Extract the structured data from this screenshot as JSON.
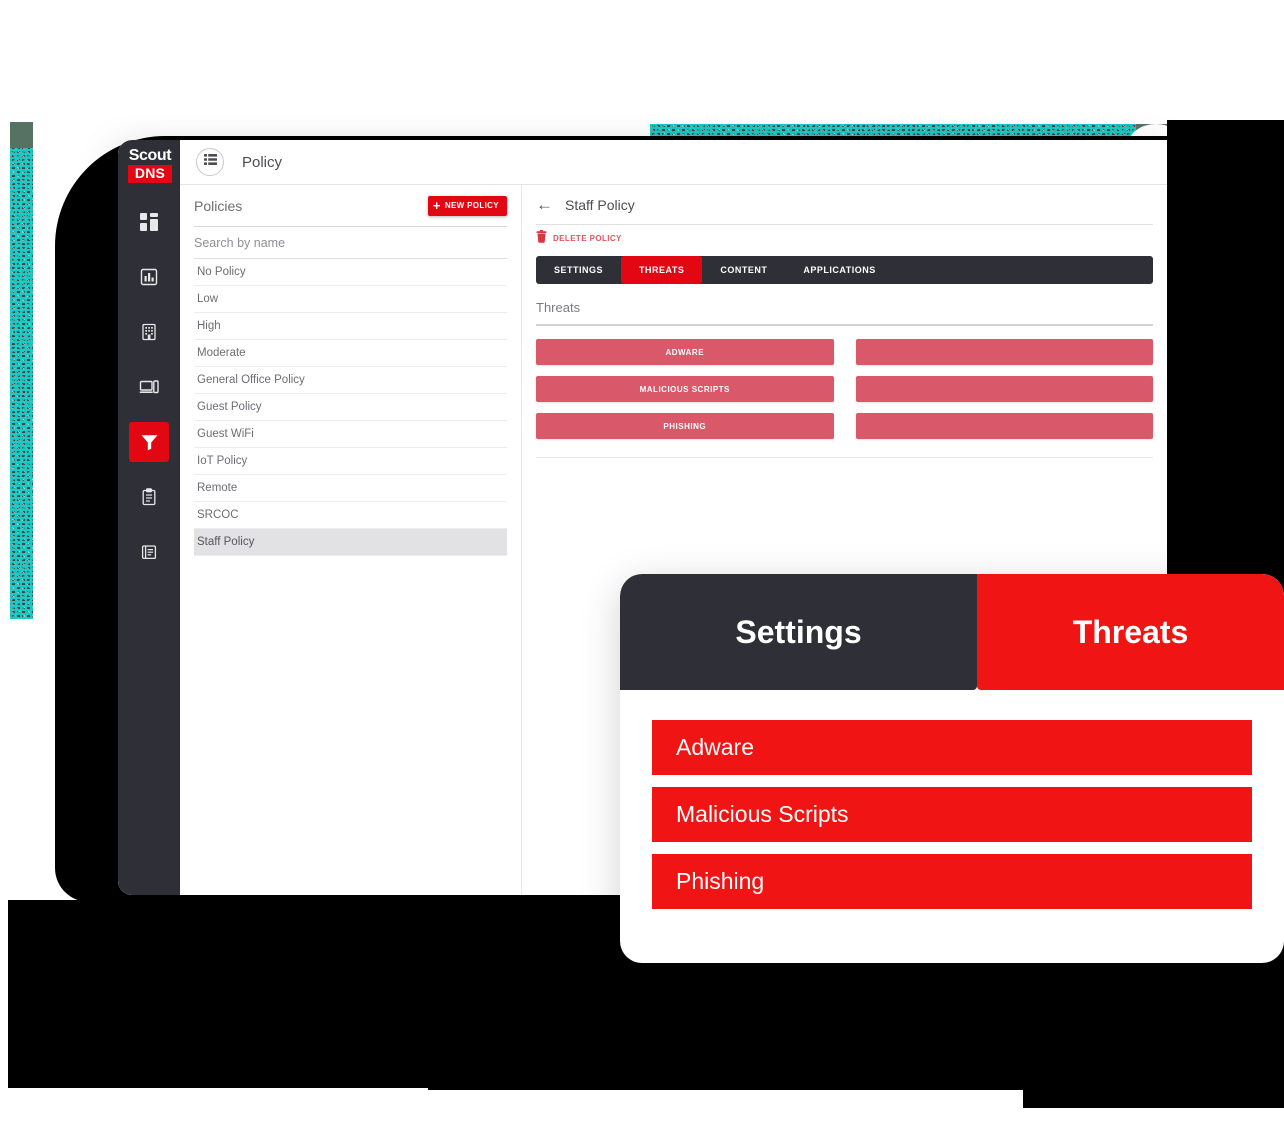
{
  "window": {
    "header": {
      "menu_icon": "list-menu-icon",
      "title": "Policy"
    },
    "logo": {
      "top": "Scout",
      "bottom": "DNS"
    },
    "sidebar": {
      "items": [
        {
          "icon": "dashboard-grid-icon",
          "active": false
        },
        {
          "icon": "bar-chart-icon",
          "active": false
        },
        {
          "icon": "building-icon",
          "active": false
        },
        {
          "icon": "devices-icon",
          "active": false
        },
        {
          "icon": "filter-funnel-icon",
          "active": true
        },
        {
          "icon": "clipboard-icon",
          "active": false
        },
        {
          "icon": "book-icon",
          "active": false
        }
      ]
    },
    "policies": {
      "title": "Policies",
      "new_button": "NEW POLICY",
      "new_button_icon": "plus-icon",
      "search_placeholder": "Search by name",
      "search_value": "",
      "items": [
        {
          "label": "No Policy",
          "selected": false
        },
        {
          "label": "Low",
          "selected": false
        },
        {
          "label": "High",
          "selected": false
        },
        {
          "label": "Moderate",
          "selected": false
        },
        {
          "label": "General Office Policy",
          "selected": false
        },
        {
          "label": "Guest Policy",
          "selected": false
        },
        {
          "label": "Guest WiFi",
          "selected": false
        },
        {
          "label": "IoT Policy",
          "selected": false
        },
        {
          "label": "Remote",
          "selected": false
        },
        {
          "label": "SRCOC",
          "selected": false
        },
        {
          "label": "Staff Policy",
          "selected": true
        }
      ]
    },
    "detail": {
      "back_icon": "back-arrow-icon",
      "title": "Staff Policy",
      "delete_icon": "trash-icon",
      "delete_label": "DELETE POLICY",
      "tabs": [
        {
          "label": "SETTINGS",
          "active": false
        },
        {
          "label": "THREATS",
          "active": true
        },
        {
          "label": "CONTENT",
          "active": false
        },
        {
          "label": "APPLICATIONS",
          "active": false
        }
      ],
      "section_label": "Threats",
      "threat_chips": [
        "ADWARE",
        "",
        "MALICIOUS SCRIPTS",
        "",
        "PHISHING",
        ""
      ]
    }
  },
  "callout": {
    "tabs": [
      {
        "label": "Settings",
        "active": false
      },
      {
        "label": "Threats",
        "active": true
      }
    ],
    "chips": [
      "Adware",
      "Malicious Scripts",
      "Phishing"
    ]
  },
  "colors": {
    "brand_red": "#e30613",
    "bright_red": "#f01414",
    "muted_red": "#d9596a",
    "dark": "#2f3037",
    "teal": "#0acdc7"
  }
}
